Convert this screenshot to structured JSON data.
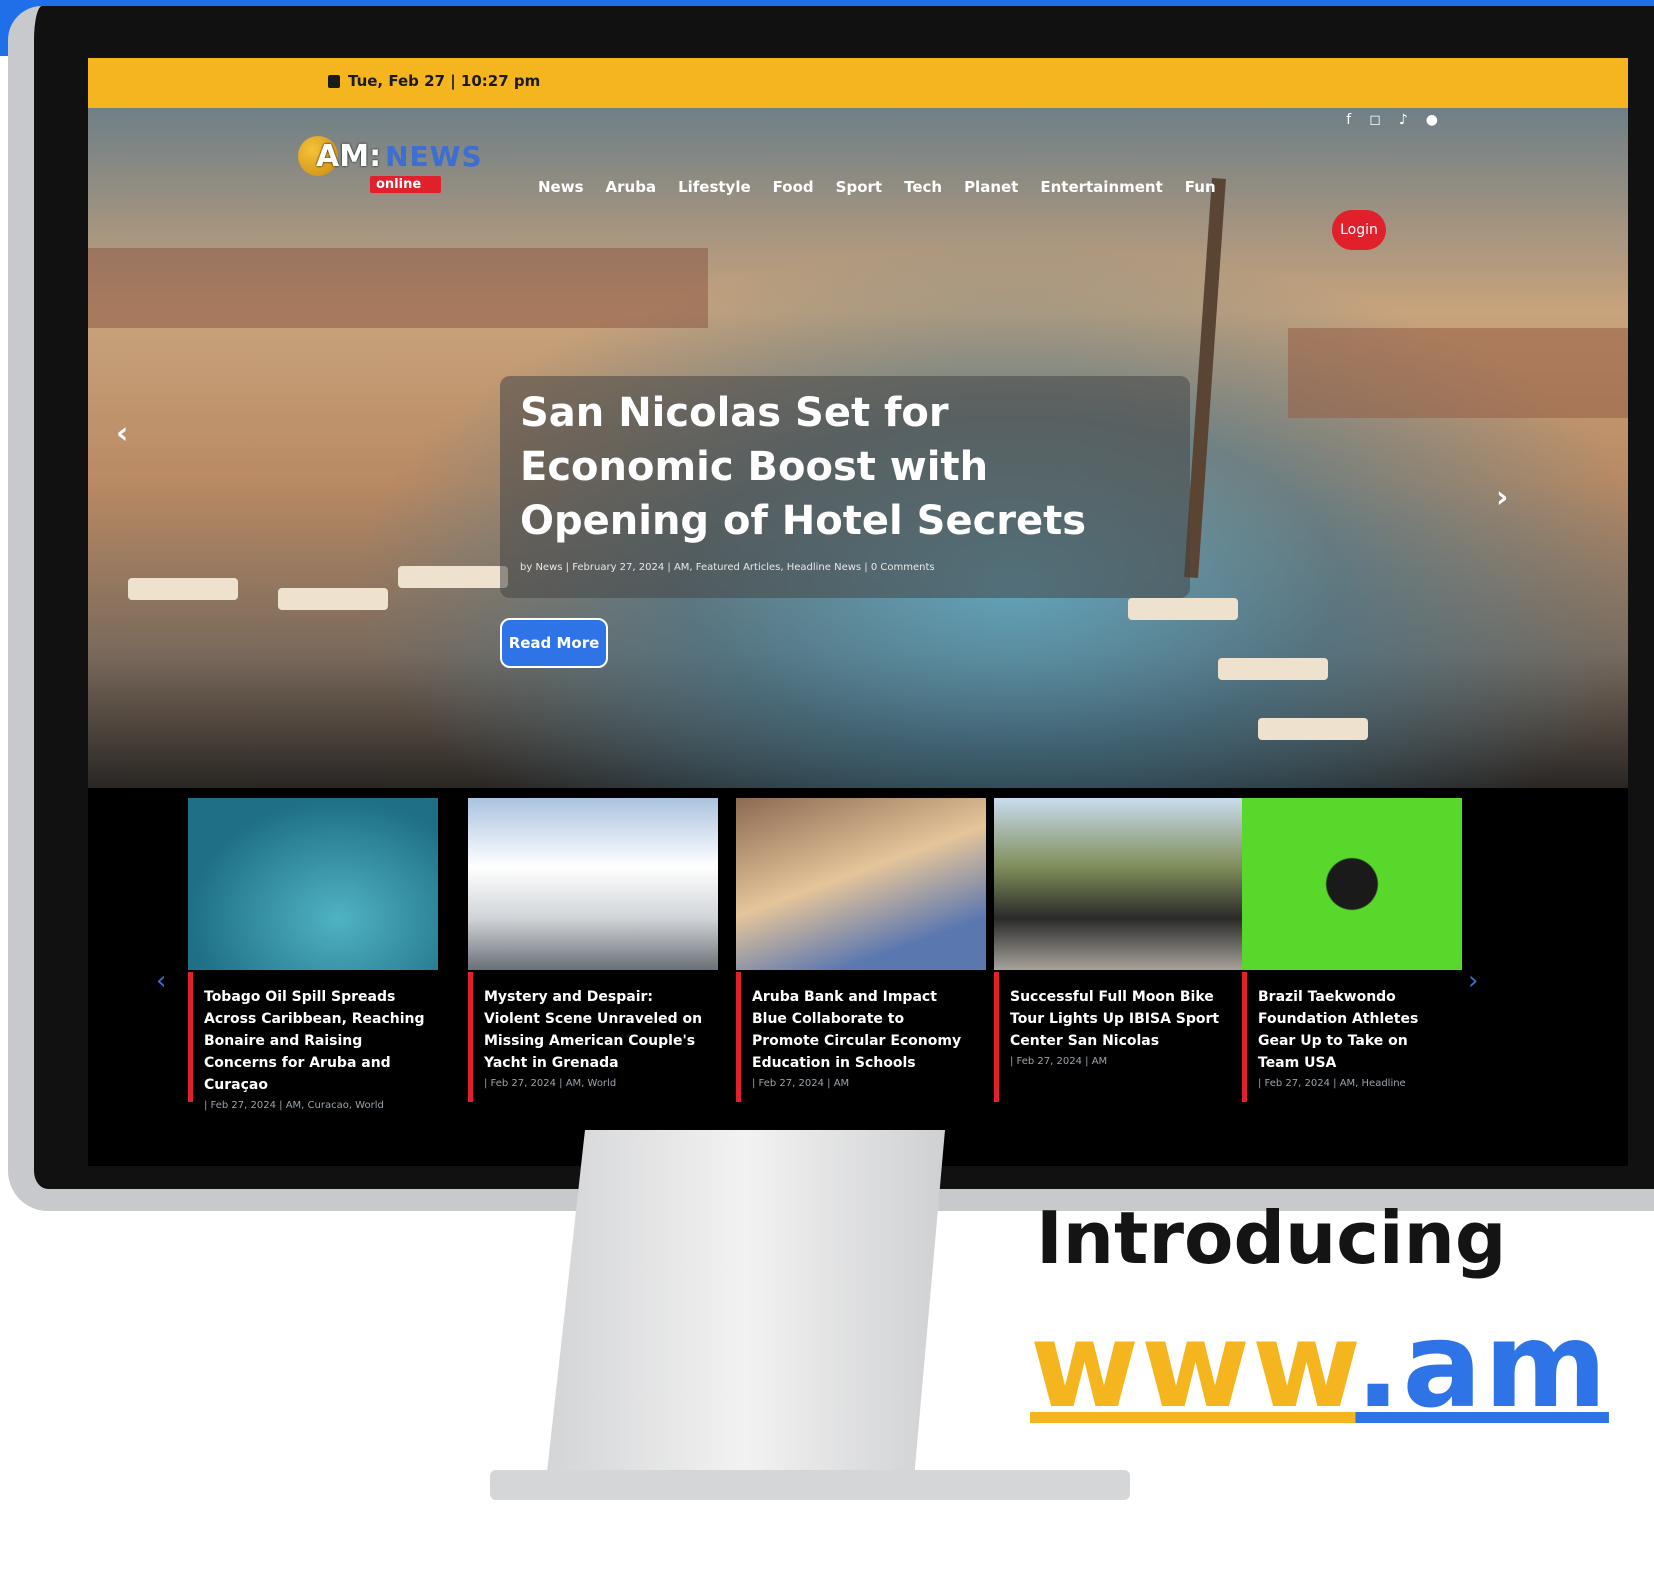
{
  "topbar": {
    "date": "Tue, Feb 27 | 10:27 pm"
  },
  "logo": {
    "am": "AM:",
    "news": "NEWS",
    "online": "online"
  },
  "nav": [
    "News",
    "Aruba",
    "Lifestyle",
    "Food",
    "Sport",
    "Tech",
    "Planet",
    "Entertainment",
    "Fun"
  ],
  "login": "Login",
  "hero": {
    "headline": "San Nicolas Set for Economic Boost with Opening of Hotel Secrets",
    "meta": "by News | February 27, 2024 | AM, Featured Articles, Headline News | 0 Comments",
    "read_more": "Read More"
  },
  "cards": [
    {
      "title": "Tobago Oil Spill Spreads Across Caribbean, Reaching Bonaire and Raising Concerns for Aruba and Curaçao",
      "meta": "| Feb 27, 2024 | AM, Curacao, World",
      "image": "oil-spill-ocean"
    },
    {
      "title": "Mystery and Despair: Violent Scene Unraveled on Missing American Couple's Yacht in Grenada",
      "meta": "| Feb 27, 2024 | AM, World",
      "image": "yacht-harbor"
    },
    {
      "title": "Aruba Bank and Impact Blue Collaborate to Promote Circular Economy Education in Schools",
      "meta": "| Feb 27, 2024 | AM",
      "image": "classroom"
    },
    {
      "title": "Successful Full Moon Bike Tour Lights Up IBISA Sport Center San Nicolas",
      "meta": "| Feb 27, 2024 | AM",
      "image": "bike-tour"
    },
    {
      "title": "Brazil Taekwondo Foundation Athletes Gear Up to Take on Team USA",
      "meta": "| Feb 27, 2024 | AM, Headline",
      "image": "train-hard-shirt"
    }
  ],
  "marketing": {
    "intro": "Introducing",
    "url_prefix": "www",
    "url_rest": ".am"
  },
  "colors": {
    "accent_yellow": "#f5b51e",
    "accent_blue": "#2f74e6",
    "accent_red": "#e0202a"
  }
}
